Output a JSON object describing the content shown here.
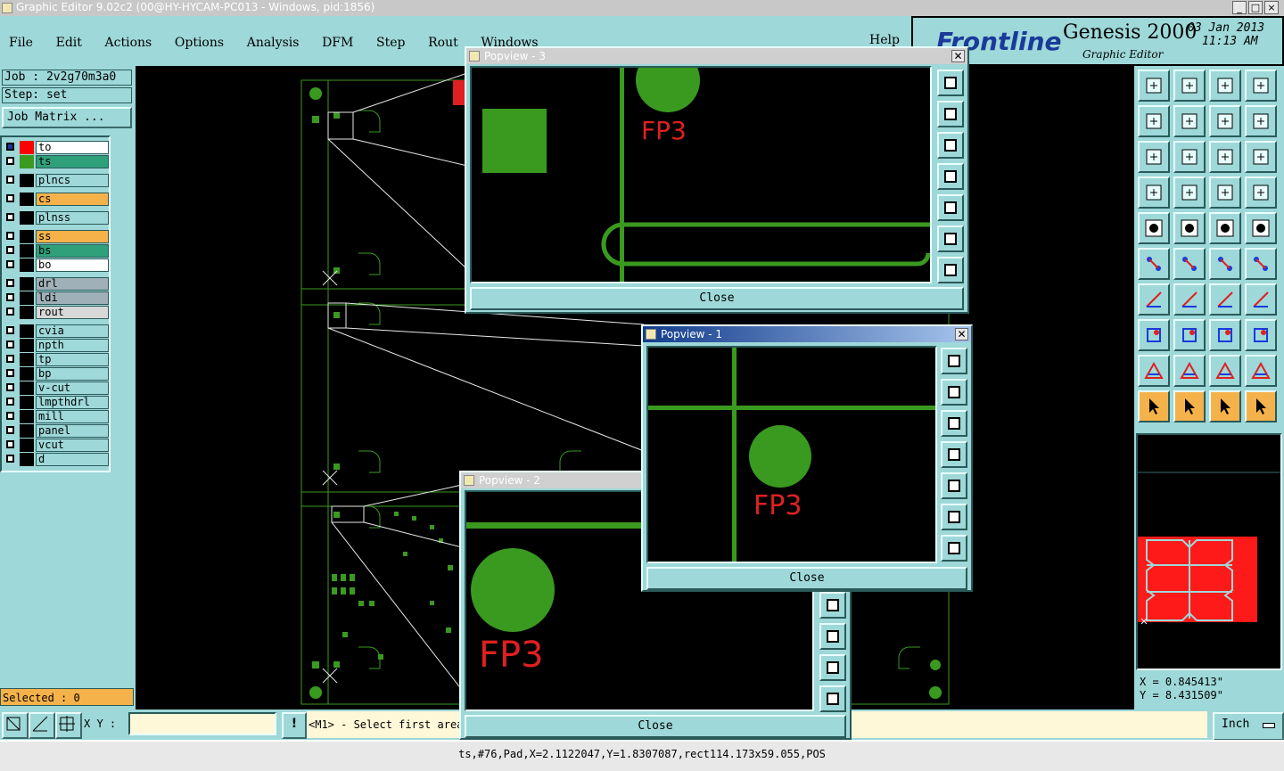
{
  "window": {
    "title": "Graphic Editor 9.02c2 (00@HY-HYCAM-PC013 - Windows, pid:1856)",
    "controls": [
      "_",
      "□",
      "×"
    ]
  },
  "menu": [
    "File",
    "Edit",
    "Actions",
    "Options",
    "Analysis",
    "DFM",
    "Step",
    "Rout",
    "Windows"
  ],
  "help_label": "Help",
  "brand": {
    "logo": "Frontline",
    "product": "Genesis 2000",
    "subtitle": "Graphic Editor",
    "date": "03 Jan 2013",
    "time": "11:13 AM"
  },
  "job": {
    "label": "Job : 2v2g70m3a0",
    "step": "Step: set",
    "matrix_button": "Job Matrix ..."
  },
  "layers": [
    {
      "name": "to",
      "color": "#ffffff",
      "swatch": "#ff0000",
      "active": true
    },
    {
      "name": "ts",
      "color": "#2fa07a",
      "swatch": "#3a9a20"
    },
    {
      "name": "plncs",
      "color": "#9ed8d8",
      "swatch": "#000000"
    },
    {
      "name": "cs",
      "color": "#f6b24a",
      "swatch": "#000000"
    },
    {
      "name": "plnss",
      "color": "#9ed8d8",
      "swatch": "#000000"
    },
    {
      "name": "ss",
      "color": "#f6b24a",
      "swatch": "#000000"
    },
    {
      "name": "bs",
      "color": "#2fa07a",
      "swatch": "#000000"
    },
    {
      "name": "bo",
      "color": "#ffffff",
      "swatch": "#000000"
    },
    {
      "name": "drl",
      "color": "#a0b0b8",
      "swatch": "#000000"
    },
    {
      "name": "ldi",
      "color": "#a0b0b8",
      "swatch": "#000000"
    },
    {
      "name": "rout",
      "color": "#d8d8d8",
      "swatch": "#000000"
    },
    {
      "name": "cvia",
      "color": "#9ed8d8",
      "swatch": "#000000"
    },
    {
      "name": "npth",
      "color": "#9ed8d8",
      "swatch": "#000000"
    },
    {
      "name": "tp",
      "color": "#9ed8d8",
      "swatch": "#000000"
    },
    {
      "name": "bp",
      "color": "#9ed8d8",
      "swatch": "#000000"
    },
    {
      "name": "v-cut",
      "color": "#9ed8d8",
      "swatch": "#000000"
    },
    {
      "name": "lmpthdrl",
      "color": "#9ed8d8",
      "swatch": "#000000"
    },
    {
      "name": "mill",
      "color": "#9ed8d8",
      "swatch": "#000000"
    },
    {
      "name": "panel",
      "color": "#9ed8d8",
      "swatch": "#000000"
    },
    {
      "name": "vcut",
      "color": "#9ed8d8",
      "swatch": "#000000"
    },
    {
      "name": "d",
      "color": "#9ed8d8",
      "swatch": "#000000"
    }
  ],
  "selected": "Selected : 0",
  "xy_label": "X Y :",
  "xy_value": "",
  "prompt": "<M1> - Select first area",
  "units": "Inch",
  "status": "ts,#76,Pad,X=2.1122047,Y=1.8307087,rect114.173x59.055,POS",
  "coords": {
    "x": "X = 0.845413\"",
    "y": "Y = 8.431509\""
  },
  "popviews": {
    "p3": {
      "title": "Popview - 3",
      "label": "FP3",
      "close": "Close"
    },
    "p1": {
      "title": "Popview - 1",
      "label": "FP3",
      "close": "Close"
    },
    "p2": {
      "title": "Popview - 2",
      "label": "FP3",
      "close": "Close"
    }
  },
  "colors": {
    "teal": "#9ed8d8",
    "orange": "#f6b24a",
    "copper": "#3a9a20",
    "label_red": "#e02020"
  }
}
